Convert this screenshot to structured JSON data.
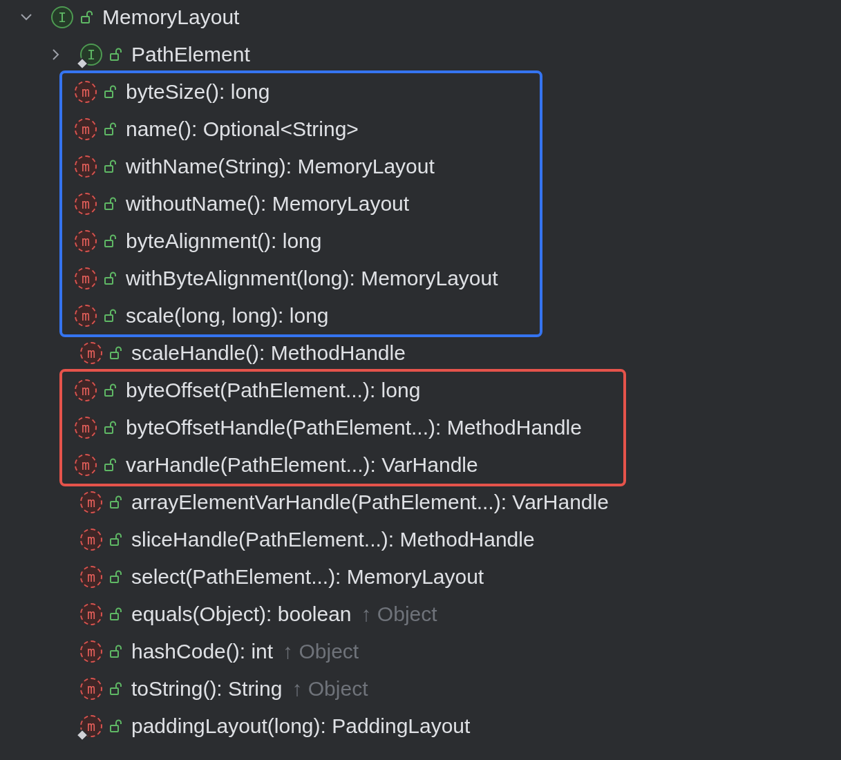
{
  "tree": {
    "name": "MemoryLayout",
    "kind": "interface",
    "badge": "I",
    "expanded": true,
    "marked": false,
    "children": [
      {
        "kind": "interface",
        "badge": "I",
        "name": "PathElement",
        "expanded": false,
        "marked": true
      },
      {
        "kind": "group",
        "color": "#3574f0",
        "items": [
          {
            "kind": "method",
            "badge": "m",
            "name": "byteSize(): long",
            "marked": false
          },
          {
            "kind": "method",
            "badge": "m",
            "name": "name(): Optional<String>",
            "marked": false
          },
          {
            "kind": "method",
            "badge": "m",
            "name": "withName(String): MemoryLayout",
            "marked": false
          },
          {
            "kind": "method",
            "badge": "m",
            "name": "withoutName(): MemoryLayout",
            "marked": false
          },
          {
            "kind": "method",
            "badge": "m",
            "name": "byteAlignment(): long",
            "marked": false
          },
          {
            "kind": "method",
            "badge": "m",
            "name": "withByteAlignment(long): MemoryLayout",
            "marked": false
          },
          {
            "kind": "method",
            "badge": "m",
            "name": "scale(long, long): long",
            "marked": false
          }
        ]
      },
      {
        "kind": "method",
        "badge": "m",
        "name": "scaleHandle(): MethodHandle",
        "marked": false
      },
      {
        "kind": "group",
        "color": "#e5534b",
        "items": [
          {
            "kind": "method",
            "badge": "m",
            "name": "byteOffset(PathElement...): long",
            "marked": false
          },
          {
            "kind": "method",
            "badge": "m",
            "name": "byteOffsetHandle(PathElement...): MethodHandle",
            "marked": false
          },
          {
            "kind": "method",
            "badge": "m",
            "name": "varHandle(PathElement...): VarHandle",
            "marked": false
          }
        ]
      },
      {
        "kind": "method",
        "badge": "m",
        "name": "arrayElementVarHandle(PathElement...): VarHandle",
        "marked": false
      },
      {
        "kind": "method",
        "badge": "m",
        "name": "sliceHandle(PathElement...): MethodHandle",
        "marked": false
      },
      {
        "kind": "method",
        "badge": "m",
        "name": "select(PathElement...): MemoryLayout",
        "marked": false
      },
      {
        "kind": "method",
        "badge": "m",
        "name": "equals(Object): boolean",
        "inherited": "↑ Object",
        "marked": false
      },
      {
        "kind": "method",
        "badge": "m",
        "name": "hashCode(): int",
        "inherited": "↑ Object",
        "marked": false
      },
      {
        "kind": "method",
        "badge": "m",
        "name": "toString(): String",
        "inherited": "↑ Object",
        "marked": false
      },
      {
        "kind": "method",
        "badge": "m",
        "name": "paddingLayout(long): PaddingLayout",
        "marked": true
      }
    ]
  }
}
